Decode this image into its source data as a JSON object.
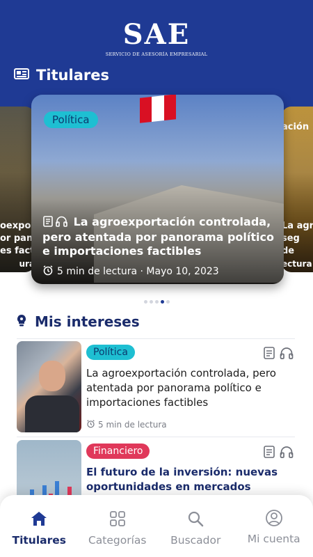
{
  "header": {
    "logo_main": "SAE",
    "logo_sub": "SERVICIO DE ASESORÍA EMPRESARIAL"
  },
  "titulares": {
    "section_title": "Titulares",
    "left_card": {
      "lines": [
        "oexporta",
        "or panora",
        "es factibl",
        "ura"
      ]
    },
    "main_card": {
      "category": "Política",
      "title": "La agroexportación controlada, pero atentada por panorama político e importaciones factibles",
      "meta": "5 min de lectura · Mayo 10, 2023"
    },
    "right_card": {
      "category": "ación",
      "lines": [
        "La agr",
        "seg",
        "de",
        "ectura"
      ]
    },
    "pagination": {
      "total": 5,
      "active_index": 3
    }
  },
  "intereses": {
    "section_title": "Mis intereses",
    "articles": [
      {
        "category": "Política",
        "title": "La agroexportación controlada, pero atentada por panorama político e importaciones factibles",
        "meta": "5 min de lectura"
      },
      {
        "category": "Financiero",
        "title": "El futuro de la inversión: nuevas oportunidades en mercados"
      }
    ]
  },
  "bottom_nav": {
    "items": [
      {
        "label": "Titulares",
        "icon": "home-icon",
        "active": true
      },
      {
        "label": "Categorías",
        "icon": "grid-icon",
        "active": false
      },
      {
        "label": "Buscador",
        "icon": "search-icon",
        "active": false
      },
      {
        "label": "Mi cuenta",
        "icon": "user-icon",
        "active": false
      }
    ]
  },
  "colors": {
    "brand": "#1f3a94",
    "brand_dark": "#1a2b6b",
    "politica": "#1ebfd2",
    "financiero": "#e0385a"
  }
}
